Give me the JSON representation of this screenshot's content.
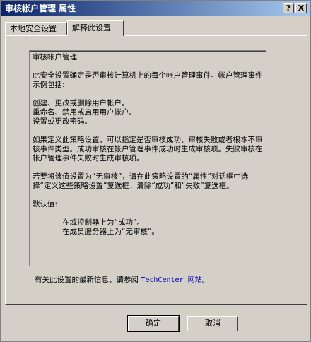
{
  "window": {
    "title": "审核帐户管理 属性",
    "help_label": "?",
    "close_label": "X"
  },
  "tabs": [
    {
      "label": "本地安全设置"
    },
    {
      "label": "解释此设置"
    }
  ],
  "explanation": {
    "heading": "审核帐户管理",
    "para1": "此安全设置确定是否审核计算机上的每个帐户管理事件。帐户管理事件示例包括:",
    "examples": [
      "创建、更改或删除用户帐户。",
      "重命名、禁用或启用用户帐户。",
      "设置或更改密码。"
    ],
    "para2": "如果定义此策略设置，可以指定是否审核成功、审核失败或者根本不审核事件类型。成功审核在帐户管理事件成功时生成审核项。失败审核在帐户管理事件失败时生成审核项。",
    "para3": "若要将该值设置为“无审核”，请在此策略设置的“属性”对话框中选择“定义这些策略设置”复选框，清除“成功”和“失败”复选框。",
    "defaults_label": "默认值:",
    "defaults": [
      "在域控制器上为“成功”。",
      "在成员服务器上为“无审核”。"
    ]
  },
  "footer": {
    "text": "有关此设置的最新信息，请参阅",
    "link": "TechCenter 网站",
    "end": "。"
  },
  "buttons": {
    "ok": "确定",
    "cancel": "取消"
  }
}
